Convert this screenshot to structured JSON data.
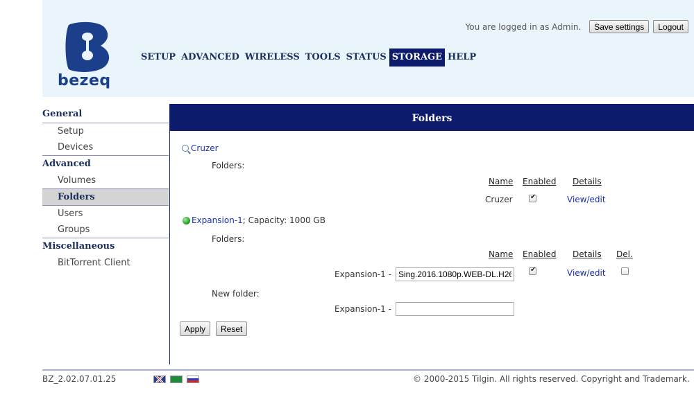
{
  "header": {
    "logo_text": "bezeq",
    "logged_in_text": "You are logged in as Admin.",
    "save_button": "Save settings",
    "logout_button": "Logout",
    "nav": [
      "SETUP",
      "ADVANCED",
      "WIRELESS",
      "TOOLS",
      "STATUS",
      "STORAGE",
      "HELP"
    ],
    "active_nav": "STORAGE"
  },
  "sidebar": {
    "sections": [
      {
        "title": "General",
        "items": [
          "Setup",
          "Devices"
        ]
      },
      {
        "title": "Advanced",
        "items": [
          "Volumes",
          "Folders",
          "Users",
          "Groups"
        ]
      },
      {
        "title": "Miscellaneous",
        "items": [
          "BitTorrent Client"
        ]
      }
    ],
    "active_item": "Folders"
  },
  "main": {
    "title": "Folders",
    "volume1": {
      "name": "Cruzer",
      "folders_label": "Folders:",
      "columns": {
        "name": "Name",
        "enabled": "Enabled",
        "details": "Details"
      },
      "row": {
        "name": "Cruzer",
        "enabled": true,
        "details": "View/edit"
      }
    },
    "volume2": {
      "name": "Expansion-1",
      "capacity": "; Capacity: 1000 GB",
      "folders_label": "Folders:",
      "columns": {
        "name": "Name",
        "enabled": "Enabled",
        "details": "Details",
        "del": "Del."
      },
      "row": {
        "prefix": "Expansion-1 -",
        "value": "Sing.2016.1080p.WEB-DL.H26",
        "enabled": true,
        "details": "View/edit",
        "del": false
      },
      "new_folder_label": "New folder:",
      "new_folder_prefix": "Expansion-1 -",
      "new_folder_value": ""
    },
    "apply_button": "Apply",
    "reset_button": "Reset"
  },
  "footer": {
    "version": "BZ_2.02.07.01.25",
    "copyright": "© 2000-2015 Tilgin. All rights reserved. Copyright and Trademark.",
    "flags": [
      "uk-flag-icon",
      "saudi-flag-icon",
      "russia-flag-icon"
    ]
  },
  "colors": {
    "brand_navy": "#0c1b6b",
    "header_bg": "#eaf4fb",
    "link_blue": "#1a2fb0",
    "logo_blue": "#1b3f8b"
  }
}
